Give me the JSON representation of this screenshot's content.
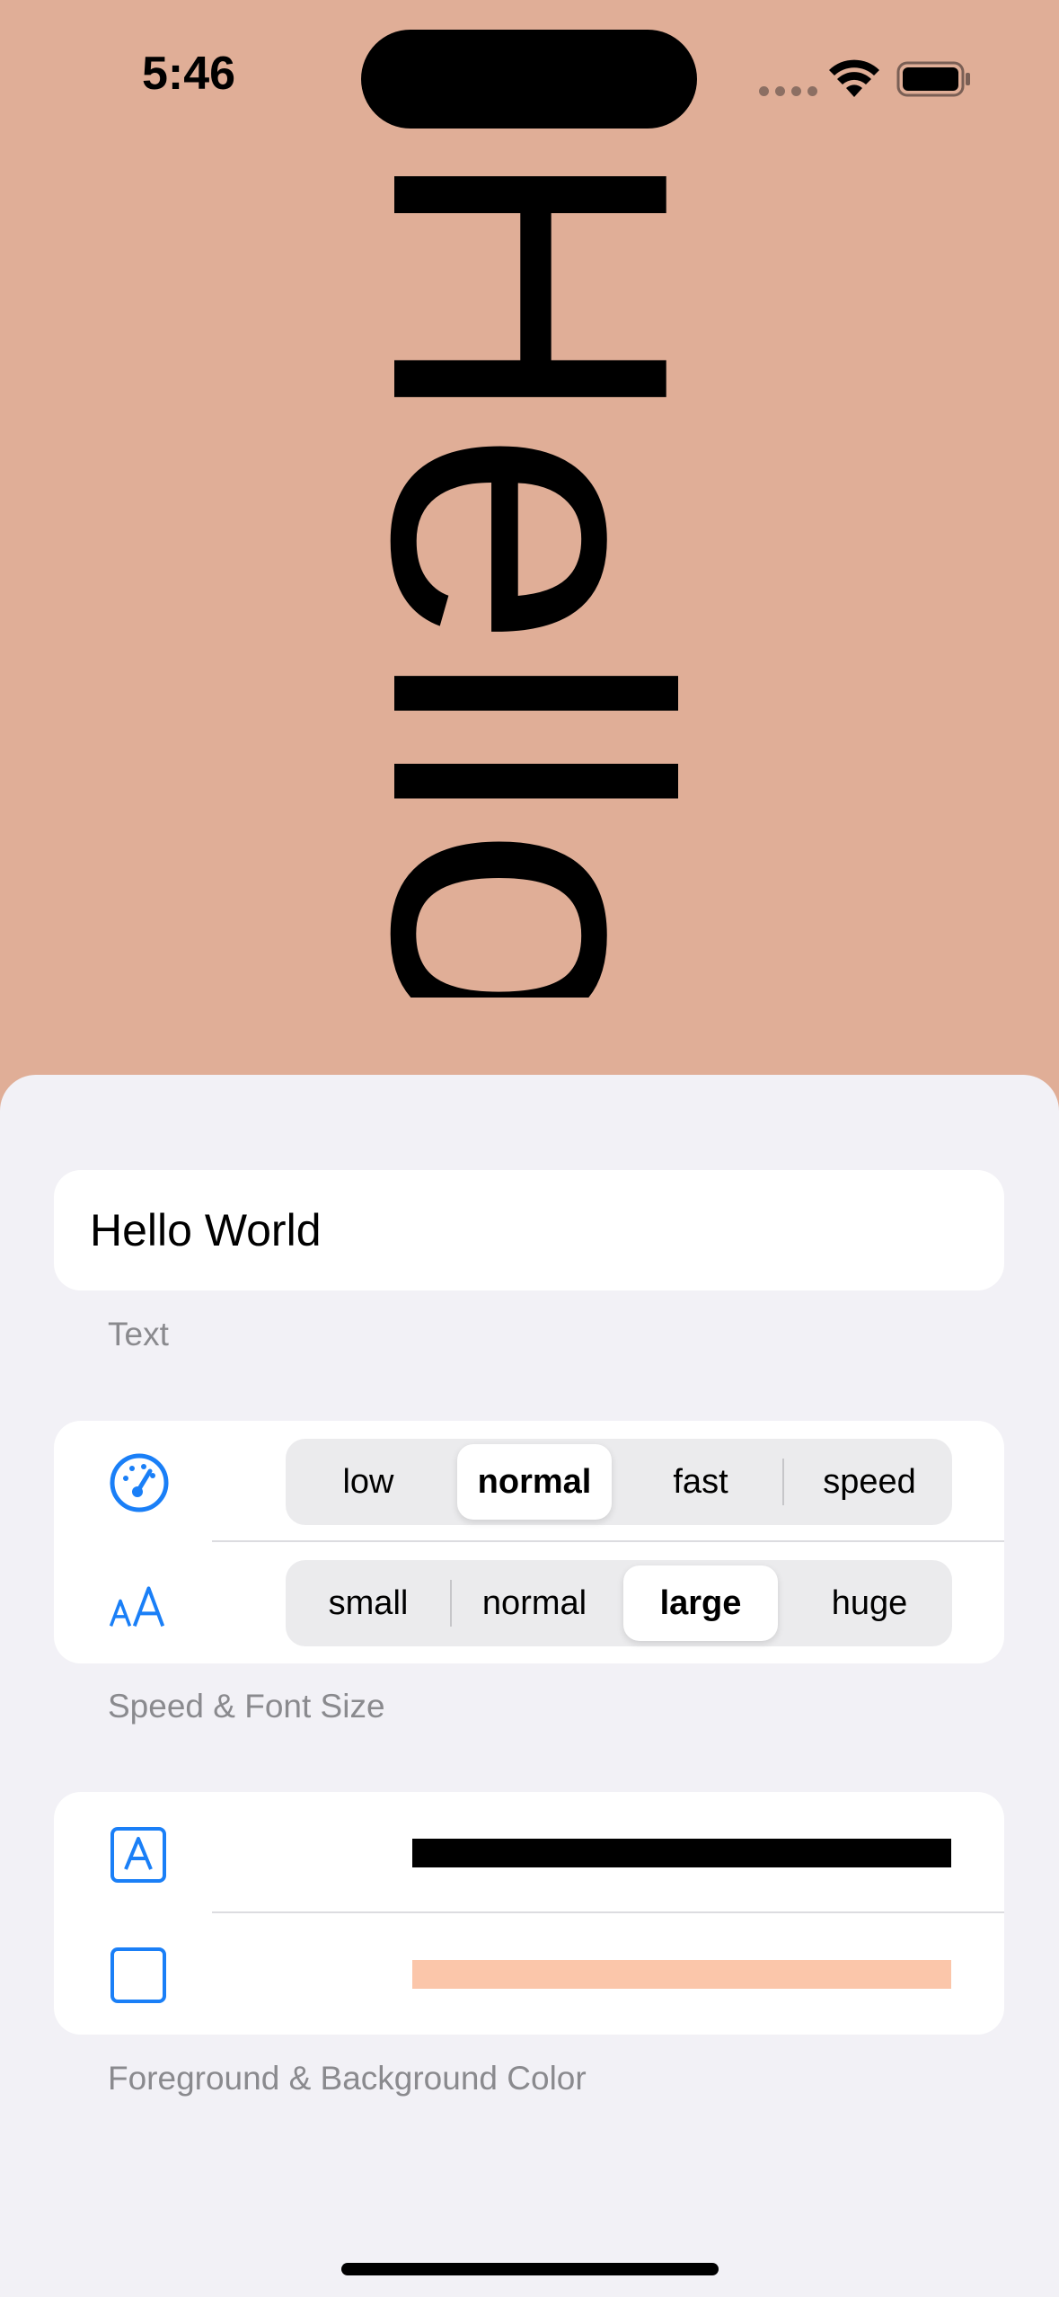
{
  "status_bar": {
    "time": "5:46"
  },
  "banner": {
    "text": "Hello",
    "text_color": "#000000",
    "background_color": "#e0ae97"
  },
  "text_section": {
    "value": "Hello World",
    "footer": "Text"
  },
  "speed_section": {
    "icon": "speedometer-icon",
    "options": [
      "low",
      "normal",
      "fast",
      "speed"
    ],
    "selected": "normal"
  },
  "font_section": {
    "icon": "textformat-size-icon",
    "icon_text": "AA",
    "options": [
      "small",
      "normal",
      "large",
      "huge"
    ],
    "selected": "large"
  },
  "speed_font_footer": "Speed & Font Size",
  "colors_section": {
    "foreground_icon": "character-square-icon",
    "foreground_icon_letter": "A",
    "foreground_color": "#000000",
    "background_icon": "square-icon",
    "background_color": "#fbc6aa",
    "footer": "Foreground & Background Color"
  },
  "accent_color": "#1a7ff7"
}
